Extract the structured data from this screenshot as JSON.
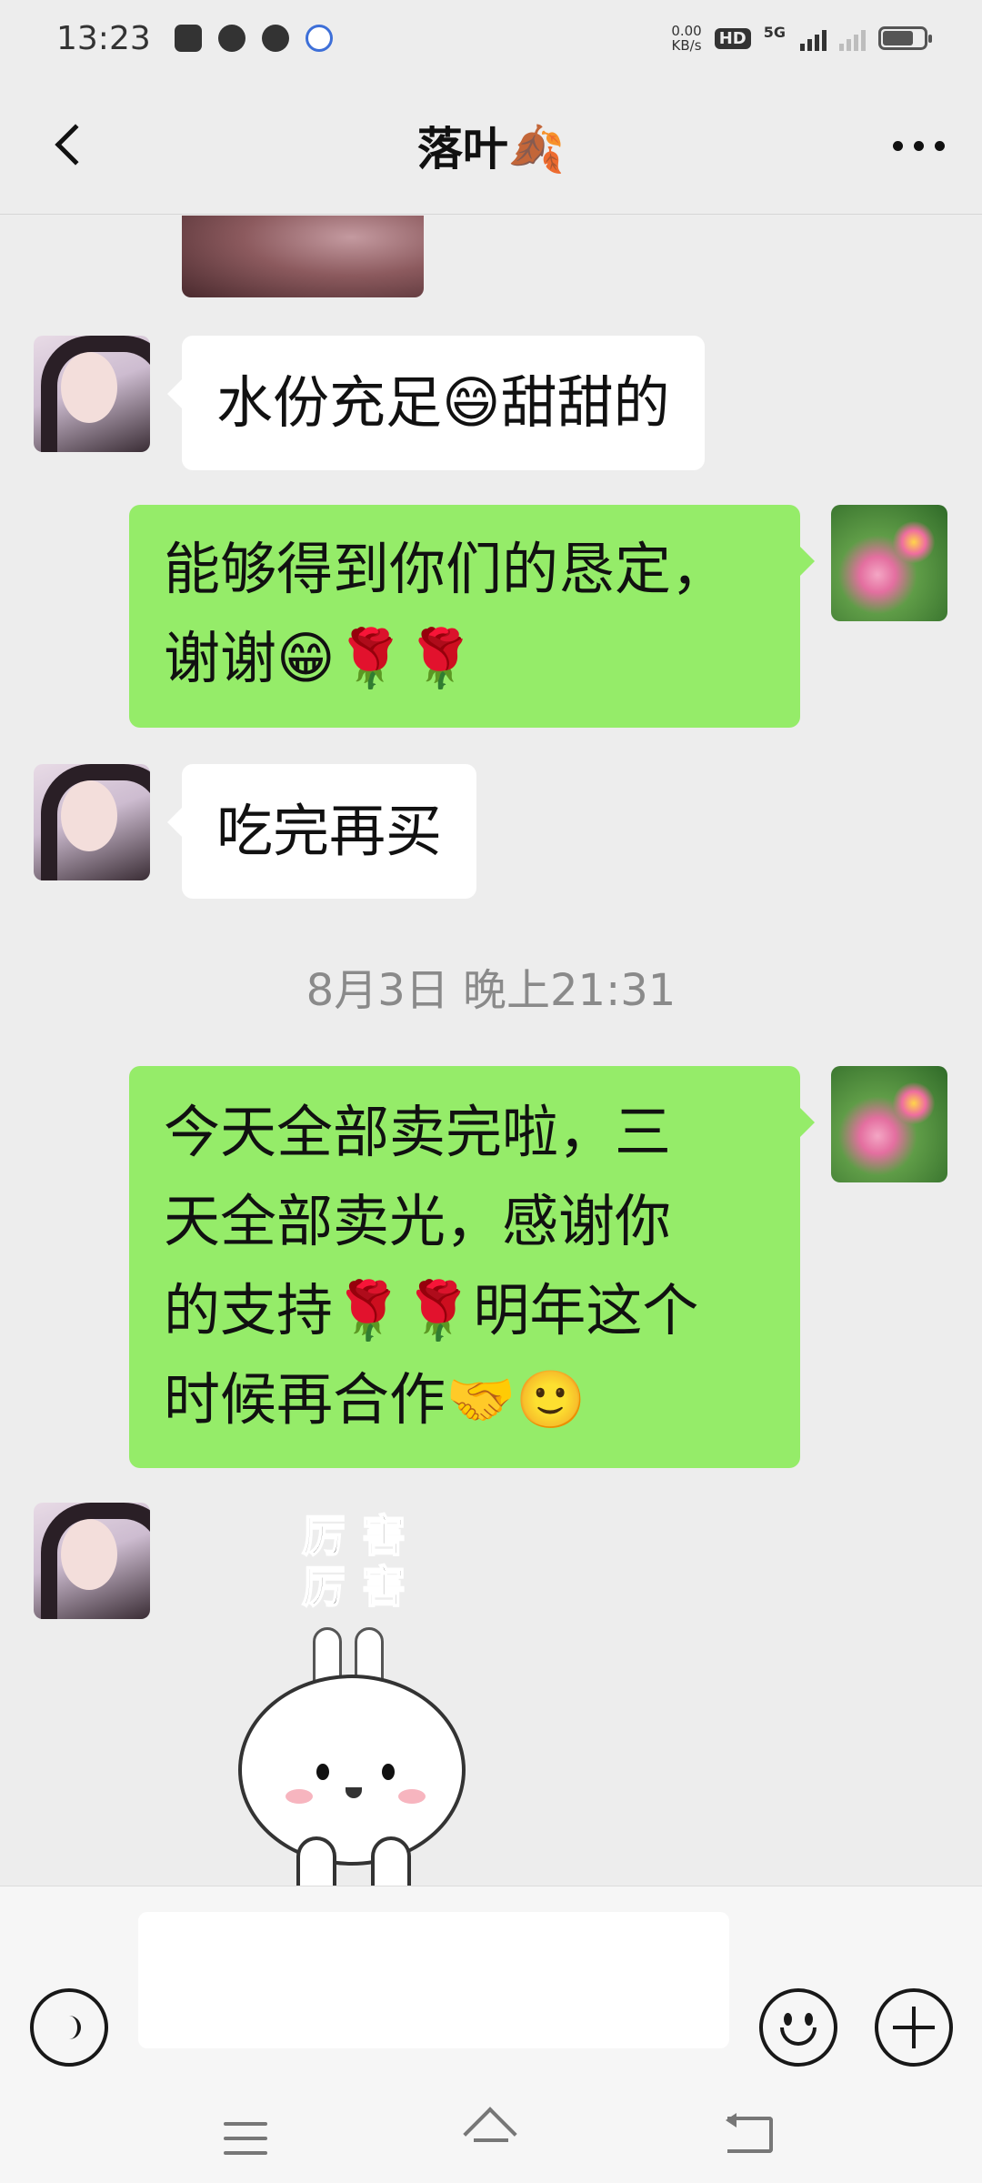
{
  "status_bar": {
    "time": "13:23",
    "net_speed_value": "0.00",
    "net_speed_unit": "KB/s",
    "hd_label": "HD",
    "network_label": "5G",
    "battery_level": 0.75
  },
  "header": {
    "title": "落叶🍂",
    "back_icon": "chevron-left-icon",
    "more_icon": "ellipsis-icon"
  },
  "messages": [
    {
      "sender": "friend",
      "type": "text",
      "text": "水份充足😄甜甜的"
    },
    {
      "sender": "me",
      "type": "text",
      "line1": "能够得到你们的恳定，",
      "line2": "谢谢😁🌹🌹"
    },
    {
      "sender": "friend",
      "type": "text",
      "text": "吃完再买"
    },
    {
      "type": "timestamp",
      "text": "8月3日 晚上21:31"
    },
    {
      "sender": "me",
      "type": "text",
      "line1": "今天全部卖完啦，三",
      "line2": "天全部卖光，感谢你",
      "line3": "的支持🌹🌹明年这个",
      "line4": "时候再合作🤝🙂"
    },
    {
      "sender": "friend",
      "type": "sticker",
      "line1": "厉害",
      "line2": "厉害"
    }
  ],
  "input_bar": {
    "voice_icon": "voice-icon",
    "text_value": "",
    "emoji_icon": "emoji-icon",
    "plus_icon": "plus-icon"
  },
  "colors": {
    "background": "#ededed",
    "outgoing_bubble": "#95ec69",
    "incoming_bubble": "#ffffff",
    "timestamp_text": "#8a8a8a"
  }
}
